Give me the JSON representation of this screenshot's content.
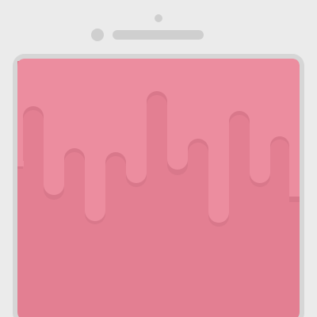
{
  "colors": {
    "background": "#ebebeb",
    "phone_frame": "#d6d6d6",
    "phone_details": "#cfcfcf",
    "screen_top": "#ec8d9f",
    "screen_bottom": "#e37f92",
    "drip_shadow": "#d9788b"
  }
}
